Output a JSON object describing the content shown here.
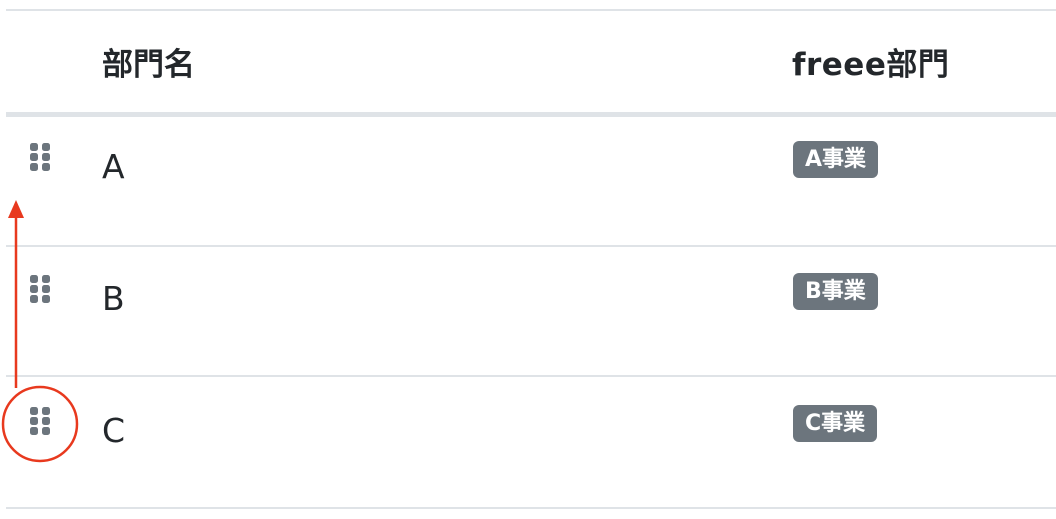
{
  "table": {
    "headers": {
      "name": "部門名",
      "freee_dept": "freee部門"
    },
    "rows": [
      {
        "name": "A",
        "freee_dept": "A事業"
      },
      {
        "name": "B",
        "freee_dept": "B事業"
      },
      {
        "name": "C",
        "freee_dept": "C事業"
      }
    ]
  },
  "icons": {
    "row_handle": "drag-handle-icon"
  },
  "colors": {
    "badge_bg": "#6c757d",
    "handle": "#6c757d",
    "annotation": "#e8391e",
    "rule": "#dfe3e7"
  }
}
